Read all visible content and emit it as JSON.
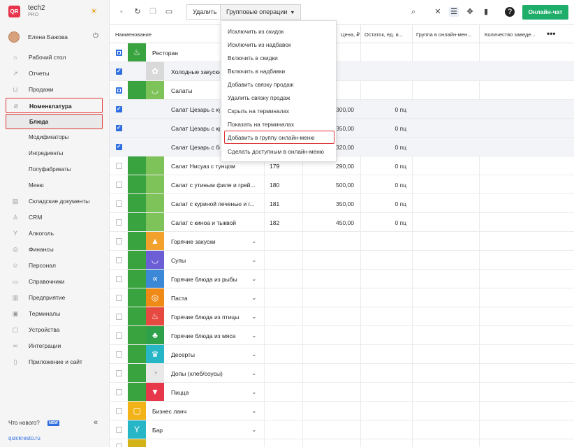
{
  "sidebar": {
    "app_name": "tech2",
    "plan": "PRO",
    "user": "Елена Бажова",
    "items": [
      {
        "label": "Рабочий стол",
        "icon": "house-icon"
      },
      {
        "label": "Отчеты",
        "icon": "chart-icon"
      },
      {
        "label": "Продажи",
        "icon": "basket-icon"
      },
      {
        "label": "Номенклатура",
        "icon": "tag-icon"
      },
      {
        "label": "Блюда",
        "icon": ""
      },
      {
        "label": "Модификаторы",
        "icon": ""
      },
      {
        "label": "Ингредиенты",
        "icon": ""
      },
      {
        "label": "Полуфабрикаты",
        "icon": ""
      },
      {
        "label": "Меню",
        "icon": ""
      },
      {
        "label": "Складские документы",
        "icon": "warehouse-icon"
      },
      {
        "label": "CRM",
        "icon": "crm-icon"
      },
      {
        "label": "Алкоголь",
        "icon": "glass-icon"
      },
      {
        "label": "Финансы",
        "icon": "coins-icon"
      },
      {
        "label": "Персонал",
        "icon": "people-icon"
      },
      {
        "label": "Справочники",
        "icon": "book-icon"
      },
      {
        "label": "Предприятие",
        "icon": "building-icon"
      },
      {
        "label": "Терминалы",
        "icon": "terminal-icon"
      },
      {
        "label": "Устройства",
        "icon": "device-icon"
      },
      {
        "label": "Интеграции",
        "icon": "link-icon"
      },
      {
        "label": "Приложение и сайт",
        "icon": "phone-icon"
      }
    ],
    "whats_new": "Что нового?",
    "new_badge": "NEW",
    "site": "quickresto.ru"
  },
  "toolbar": {
    "delete_label": "Удалить",
    "group_ops_label": "Групповые операции",
    "chat_label": "Онлайн-чат"
  },
  "table": {
    "headers": [
      "Наименование",
      "Цена, ₽",
      "Остаток, ед. и...",
      "Группа в онлайн-мен...",
      "Количество заведе..."
    ],
    "rows": [
      {
        "name": "Ресторан",
        "code": "",
        "price": "",
        "stock": ""
      },
      {
        "name": "Холодные закуски",
        "code": "",
        "price": "",
        "stock": ""
      },
      {
        "name": "Салаты",
        "code": "",
        "price": "",
        "stock": ""
      },
      {
        "name": "Салат Цезарь с ку",
        "code": "",
        "price": "300,00",
        "stock": "0 пц"
      },
      {
        "name": "Салат Цезарь с кр",
        "code": "",
        "price": "350,00",
        "stock": "0 пц"
      },
      {
        "name": "Салат Цезарь с бе",
        "code": "",
        "price": "320,00",
        "stock": "0 пц"
      },
      {
        "name": "Салат Нисуаз с тунцом",
        "code": "179",
        "price": "290,00",
        "stock": "0 пц"
      },
      {
        "name": "Салат с утиным филе и грей...",
        "code": "180",
        "price": "500,00",
        "stock": "0 пц"
      },
      {
        "name": "Салат с куриной печенью и г...",
        "code": "181",
        "price": "350,00",
        "stock": "0 пц"
      },
      {
        "name": "Салат с киноа и тыквой",
        "code": "182",
        "price": "450,00",
        "stock": "0 пц"
      },
      {
        "name": "Горячие закуски",
        "code": "",
        "price": "",
        "stock": ""
      },
      {
        "name": "Супы",
        "code": "",
        "price": "",
        "stock": ""
      },
      {
        "name": "Горячие блюда из рыбы",
        "code": "",
        "price": "",
        "stock": ""
      },
      {
        "name": "Паста",
        "code": "",
        "price": "",
        "stock": ""
      },
      {
        "name": "Горячие блюда из птицы",
        "code": "",
        "price": "",
        "stock": ""
      },
      {
        "name": "Горячие блюда из мяса",
        "code": "",
        "price": "",
        "stock": ""
      },
      {
        "name": "Десерты",
        "code": "",
        "price": "",
        "stock": ""
      },
      {
        "name": "Допы (хлеб/соусы)",
        "code": "",
        "price": "",
        "stock": ""
      },
      {
        "name": "Пицца",
        "code": "",
        "price": "",
        "stock": ""
      },
      {
        "name": "Бизнес ланч",
        "code": "",
        "price": "",
        "stock": ""
      },
      {
        "name": "Бар",
        "code": "",
        "price": "",
        "stock": ""
      }
    ]
  },
  "dropdown": {
    "items": [
      "Исключить из скидок",
      "Исключить из надбавок",
      "Включить в скидки",
      "Включить в надбавки",
      "Добавить связку продаж",
      "Удалить связку продаж",
      "Скрыть на терминалах",
      "Показать на терминалах",
      "Добавить в группу онлайн-меню",
      "Сделать доступным в онлайн-меню"
    ]
  },
  "colors": {
    "accent": "#2f6ee0",
    "chat": "#1fad6a",
    "highlight": "#e13333"
  }
}
